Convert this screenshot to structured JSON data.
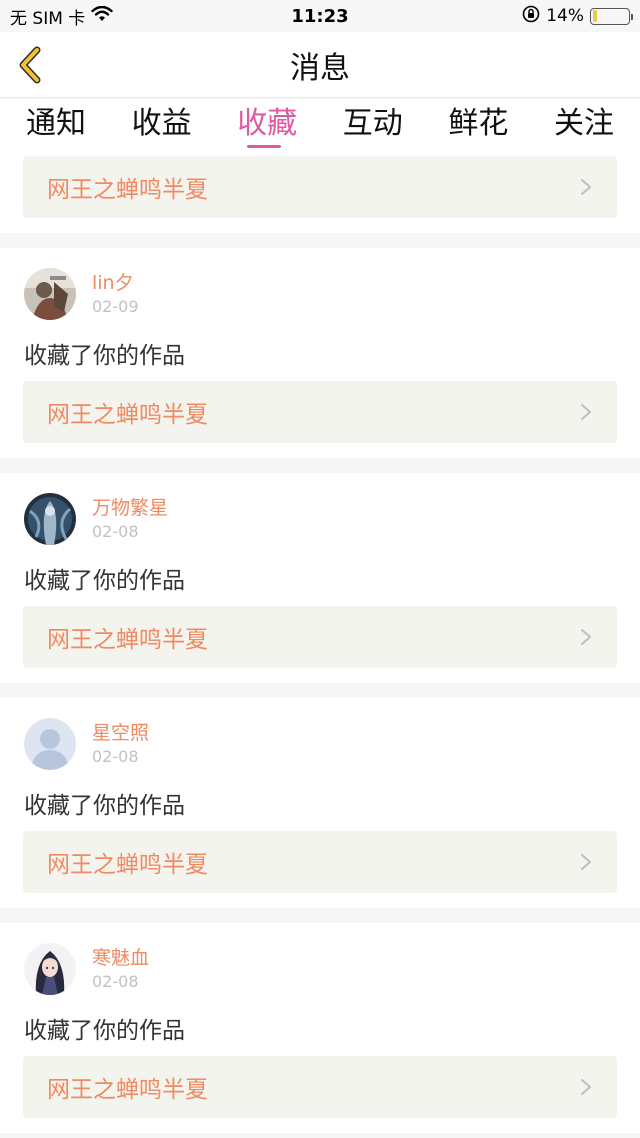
{
  "status_bar": {
    "carrier": "无 SIM 卡",
    "time": "11:23",
    "battery_percent": "14%",
    "battery_level": 0.14,
    "icons": [
      "wifi-icon",
      "rotation-lock-icon",
      "battery-icon"
    ]
  },
  "header": {
    "title": "消息",
    "back_icon": "chevron-left-icon"
  },
  "tabs": [
    {
      "label": "通知"
    },
    {
      "label": "收益"
    },
    {
      "label": "收藏"
    },
    {
      "label": "互动"
    },
    {
      "label": "鲜花"
    },
    {
      "label": "关注"
    }
  ],
  "active_tab": "收藏",
  "top_partial_item": {
    "work_title": "网王之蝉鸣半夏"
  },
  "messages": [
    {
      "username": "lin夕",
      "date": "02-09",
      "action": "收藏了你的作品",
      "work_title": "网王之蝉鸣半夏",
      "avatar": "avatar-photo"
    },
    {
      "username": "万物繁星",
      "date": "02-08",
      "action": "收藏了你的作品",
      "work_title": "网王之蝉鸣半夏",
      "avatar": "avatar-photo"
    },
    {
      "username": "星空照",
      "date": "02-08",
      "action": "收藏了你的作品",
      "work_title": "网王之蝉鸣半夏",
      "avatar": "default-avatar-icon"
    },
    {
      "username": "寒魅血",
      "date": "02-08",
      "action": "收藏了你的作品",
      "work_title": "网王之蝉鸣半夏",
      "avatar": "avatar-photo"
    }
  ],
  "colors": {
    "accent_pink": "#e05aa3",
    "username_orange": "#ef8a63",
    "back_arrow_yellow": "#f2c230",
    "link_bg": "#f4f4ee"
  }
}
